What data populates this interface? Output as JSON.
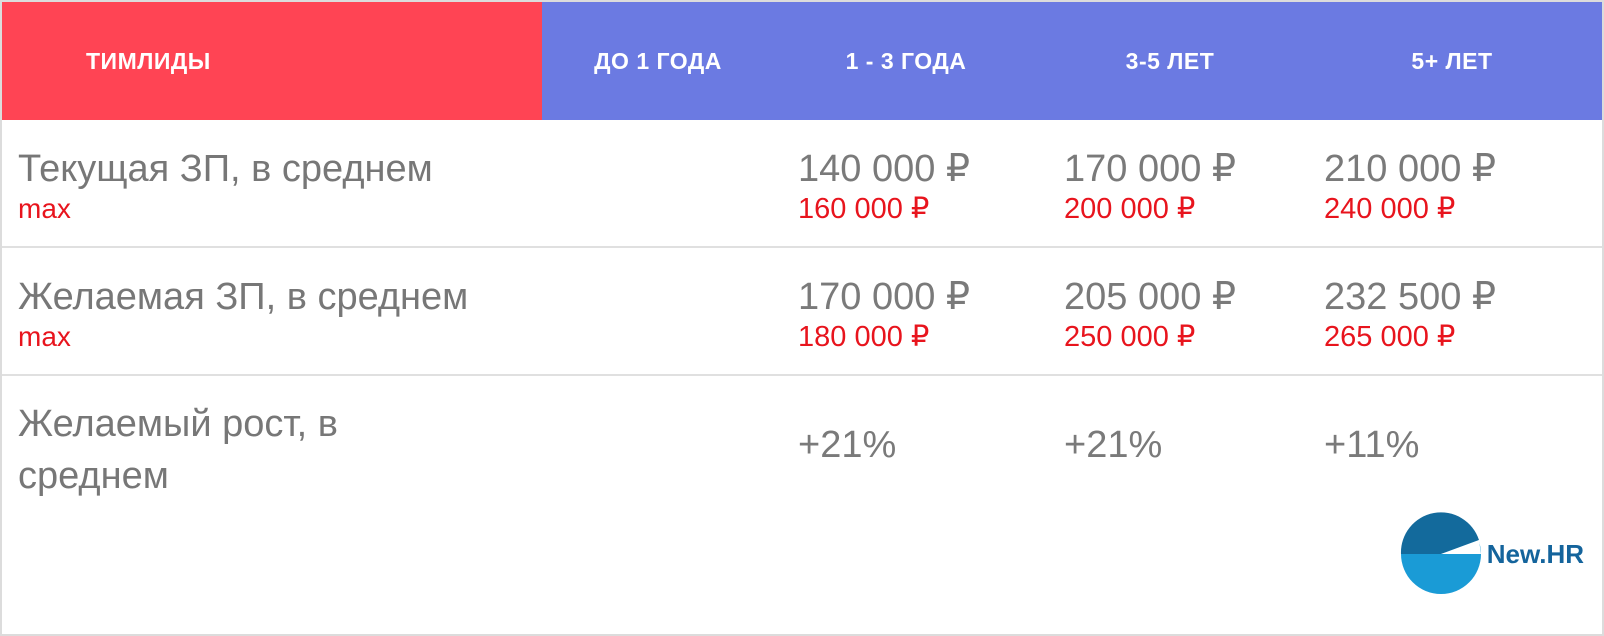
{
  "header": {
    "team": "ТИМЛИДЫ",
    "col1": "ДО 1 ГОДА",
    "col2": "1 - 3 ГОДА",
    "col3": "3-5 ЛЕТ",
    "col4": "5+ ЛЕТ"
  },
  "rows": [
    {
      "label": "Текущая ЗП, в среднем",
      "max_label": "max",
      "values": [
        "140 000 ₽",
        "170 000 ₽",
        "210 000 ₽"
      ],
      "max_values": [
        "160 000 ₽",
        "200 000 ₽",
        "240 000 ₽"
      ]
    },
    {
      "label": "Желаемая ЗП, в среднем",
      "max_label": "max",
      "values": [
        "170 000 ₽",
        "205 000 ₽",
        "232 500 ₽"
      ],
      "max_values": [
        "180 000 ₽",
        "250 000 ₽",
        "265 000 ₽"
      ]
    },
    {
      "label": "Желаемый рост, в среднем",
      "values": [
        "+21%",
        "+21%",
        "+11%"
      ]
    }
  ],
  "logo": {
    "text": "New.HR",
    "icon": "newhr-logo-icon"
  },
  "colors": {
    "team_header": "#ff4454",
    "range_header": "#6b7ae2",
    "max": "#e8141d",
    "text": "#777777",
    "logo": "#14649c"
  }
}
